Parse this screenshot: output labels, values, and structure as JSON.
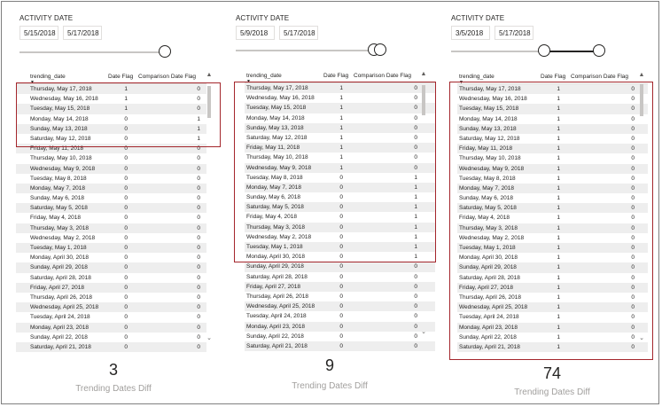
{
  "panels": [
    {
      "title": "ACTIVITY DATE",
      "start_date": "5/15/2018",
      "end_date": "5/17/2018",
      "headers": [
        "trending_date",
        "Date Flag",
        "Comparison Date Flag"
      ],
      "rows": [
        [
          "Thursday, May 17, 2018",
          "1",
          "0"
        ],
        [
          "Wednesday, May 16, 2018",
          "1",
          "0"
        ],
        [
          "Tuesday, May 15, 2018",
          "1",
          "0"
        ],
        [
          "Monday, May 14, 2018",
          "0",
          "1"
        ],
        [
          "Sunday, May 13, 2018",
          "0",
          "1"
        ],
        [
          "Saturday, May 12, 2018",
          "0",
          "1"
        ],
        [
          "Friday, May 11, 2018",
          "0",
          "0"
        ],
        [
          "Thursday, May 10, 2018",
          "0",
          "0"
        ],
        [
          "Wednesday, May 9, 2018",
          "0",
          "0"
        ],
        [
          "Tuesday, May 8, 2018",
          "0",
          "0"
        ],
        [
          "Monday, May 7, 2018",
          "0",
          "0"
        ],
        [
          "Sunday, May 6, 2018",
          "0",
          "0"
        ],
        [
          "Saturday, May 5, 2018",
          "0",
          "0"
        ],
        [
          "Friday, May 4, 2018",
          "0",
          "0"
        ],
        [
          "Thursday, May 3, 2018",
          "0",
          "0"
        ],
        [
          "Wednesday, May 2, 2018",
          "0",
          "0"
        ],
        [
          "Tuesday, May 1, 2018",
          "0",
          "0"
        ],
        [
          "Monday, April 30, 2018",
          "0",
          "0"
        ],
        [
          "Sunday, April 29, 2018",
          "0",
          "0"
        ],
        [
          "Saturday, April 28, 2018",
          "0",
          "0"
        ],
        [
          "Friday, April 27, 2018",
          "0",
          "0"
        ],
        [
          "Thursday, April 26, 2018",
          "0",
          "0"
        ],
        [
          "Wednesday, April 25, 2018",
          "0",
          "0"
        ],
        [
          "Tuesday, April 24, 2018",
          "0",
          "0"
        ],
        [
          "Monday, April 23, 2018",
          "0",
          "0"
        ],
        [
          "Sunday, April 22, 2018",
          "0",
          "0"
        ],
        [
          "Saturday, April 21, 2018",
          "0",
          "0"
        ]
      ],
      "kpi_value": "3",
      "kpi_label": "Trending Dates Diff"
    },
    {
      "title": "ACTIVITY DATE",
      "start_date": "5/9/2018",
      "end_date": "5/17/2018",
      "headers": [
        "trending_date",
        "Date Flag",
        "Comparison Date Flag"
      ],
      "rows": [
        [
          "Thursday, May 17, 2018",
          "1",
          "0"
        ],
        [
          "Wednesday, May 16, 2018",
          "1",
          "0"
        ],
        [
          "Tuesday, May 15, 2018",
          "1",
          "0"
        ],
        [
          "Monday, May 14, 2018",
          "1",
          "0"
        ],
        [
          "Sunday, May 13, 2018",
          "1",
          "0"
        ],
        [
          "Saturday, May 12, 2018",
          "1",
          "0"
        ],
        [
          "Friday, May 11, 2018",
          "1",
          "0"
        ],
        [
          "Thursday, May 10, 2018",
          "1",
          "0"
        ],
        [
          "Wednesday, May 9, 2018",
          "1",
          "0"
        ],
        [
          "Tuesday, May 8, 2018",
          "0",
          "1"
        ],
        [
          "Monday, May 7, 2018",
          "0",
          "1"
        ],
        [
          "Sunday, May 6, 2018",
          "0",
          "1"
        ],
        [
          "Saturday, May 5, 2018",
          "0",
          "1"
        ],
        [
          "Friday, May 4, 2018",
          "0",
          "1"
        ],
        [
          "Thursday, May 3, 2018",
          "0",
          "1"
        ],
        [
          "Wednesday, May 2, 2018",
          "0",
          "1"
        ],
        [
          "Tuesday, May 1, 2018",
          "0",
          "1"
        ],
        [
          "Monday, April 30, 2018",
          "0",
          "1"
        ],
        [
          "Sunday, April 29, 2018",
          "0",
          "0"
        ],
        [
          "Saturday, April 28, 2018",
          "0",
          "0"
        ],
        [
          "Friday, April 27, 2018",
          "0",
          "0"
        ],
        [
          "Thursday, April 26, 2018",
          "0",
          "0"
        ],
        [
          "Wednesday, April 25, 2018",
          "0",
          "0"
        ],
        [
          "Tuesday, April 24, 2018",
          "0",
          "0"
        ],
        [
          "Monday, April 23, 2018",
          "0",
          "0"
        ],
        [
          "Sunday, April 22, 2018",
          "0",
          "0"
        ],
        [
          "Saturday, April 21, 2018",
          "0",
          "0"
        ]
      ],
      "kpi_value": "9",
      "kpi_label": "Trending Dates Diff"
    },
    {
      "title": "ACTIVITY DATE",
      "start_date": "3/5/2018",
      "end_date": "5/17/2018",
      "headers": [
        "trending_date",
        "Date Flag",
        "Comparison Date Flag"
      ],
      "rows": [
        [
          "Thursday, May 17, 2018",
          "1",
          "0"
        ],
        [
          "Wednesday, May 16, 2018",
          "1",
          "0"
        ],
        [
          "Tuesday, May 15, 2018",
          "1",
          "0"
        ],
        [
          "Monday, May 14, 2018",
          "1",
          "0"
        ],
        [
          "Sunday, May 13, 2018",
          "1",
          "0"
        ],
        [
          "Saturday, May 12, 2018",
          "1",
          "0"
        ],
        [
          "Friday, May 11, 2018",
          "1",
          "0"
        ],
        [
          "Thursday, May 10, 2018",
          "1",
          "0"
        ],
        [
          "Wednesday, May 9, 2018",
          "1",
          "0"
        ],
        [
          "Tuesday, May 8, 2018",
          "1",
          "0"
        ],
        [
          "Monday, May 7, 2018",
          "1",
          "0"
        ],
        [
          "Sunday, May 6, 2018",
          "1",
          "0"
        ],
        [
          "Saturday, May 5, 2018",
          "1",
          "0"
        ],
        [
          "Friday, May 4, 2018",
          "1",
          "0"
        ],
        [
          "Thursday, May 3, 2018",
          "1",
          "0"
        ],
        [
          "Wednesday, May 2, 2018",
          "1",
          "0"
        ],
        [
          "Tuesday, May 1, 2018",
          "1",
          "0"
        ],
        [
          "Monday, April 30, 2018",
          "1",
          "0"
        ],
        [
          "Sunday, April 29, 2018",
          "1",
          "0"
        ],
        [
          "Saturday, April 28, 2018",
          "1",
          "0"
        ],
        [
          "Friday, April 27, 2018",
          "1",
          "0"
        ],
        [
          "Thursday, April 26, 2018",
          "1",
          "0"
        ],
        [
          "Wednesday, April 25, 2018",
          "1",
          "0"
        ],
        [
          "Tuesday, April 24, 2018",
          "1",
          "0"
        ],
        [
          "Monday, April 23, 2018",
          "1",
          "0"
        ],
        [
          "Sunday, April 22, 2018",
          "1",
          "0"
        ],
        [
          "Saturday, April 21, 2018",
          "1",
          "0"
        ]
      ],
      "kpi_value": "74",
      "kpi_label": "Trending Dates Diff"
    }
  ],
  "icons": {
    "sort": "sort-descending-icon",
    "scroll_up": "chevron-up-icon",
    "scroll_down": "chevron-down-icon",
    "slider_handle": "slider-handle-icon"
  },
  "colors": {
    "highlight_border": "#a4262c",
    "row_band": "#eeeeee",
    "kpi_label": "#a19f9d",
    "text": "#252423"
  }
}
